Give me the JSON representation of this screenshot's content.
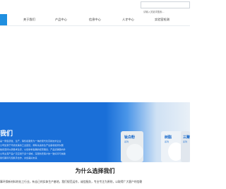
{
  "header": {
    "search_placeholder": "请输入关键词搜索..."
  },
  "nav": {
    "items": [
      {
        "label": "关于我们"
      },
      {
        "label": "产品中心"
      },
      {
        "label": "信息中心"
      },
      {
        "label": "人才中心"
      },
      {
        "label": "实验室检测"
      }
    ]
  },
  "intro": {
    "title": "我们",
    "lines": [
      "是一家集研发、生产、销售和服务为一体的现代化高新技术企业",
      "公司坐落于环境优美的工业园区，拥有先进的生产设备和检测仪器",
      "始终坚持以质量求生存、以创新求发展的经营理念，产品远销国内外",
      "公司主营产品广泛应用于多个领域，深受新老客户的一致好评与信赖",
      "我们期待与您携手合作，共创美好未来"
    ]
  },
  "cards": [
    {
      "label": "钛白粉",
      "sub": "系列"
    },
    {
      "label": "树脂",
      "sub": "系列"
    },
    {
      "label": "三聚",
      "sub": "系列"
    }
  ],
  "why": {
    "title": "为什么选择我们",
    "text": "事环保新材料的化工行业，有自己的实体生产基地，我们规范运作，诚信服务，专业专注为原则，以取得广大客户的信赖"
  }
}
